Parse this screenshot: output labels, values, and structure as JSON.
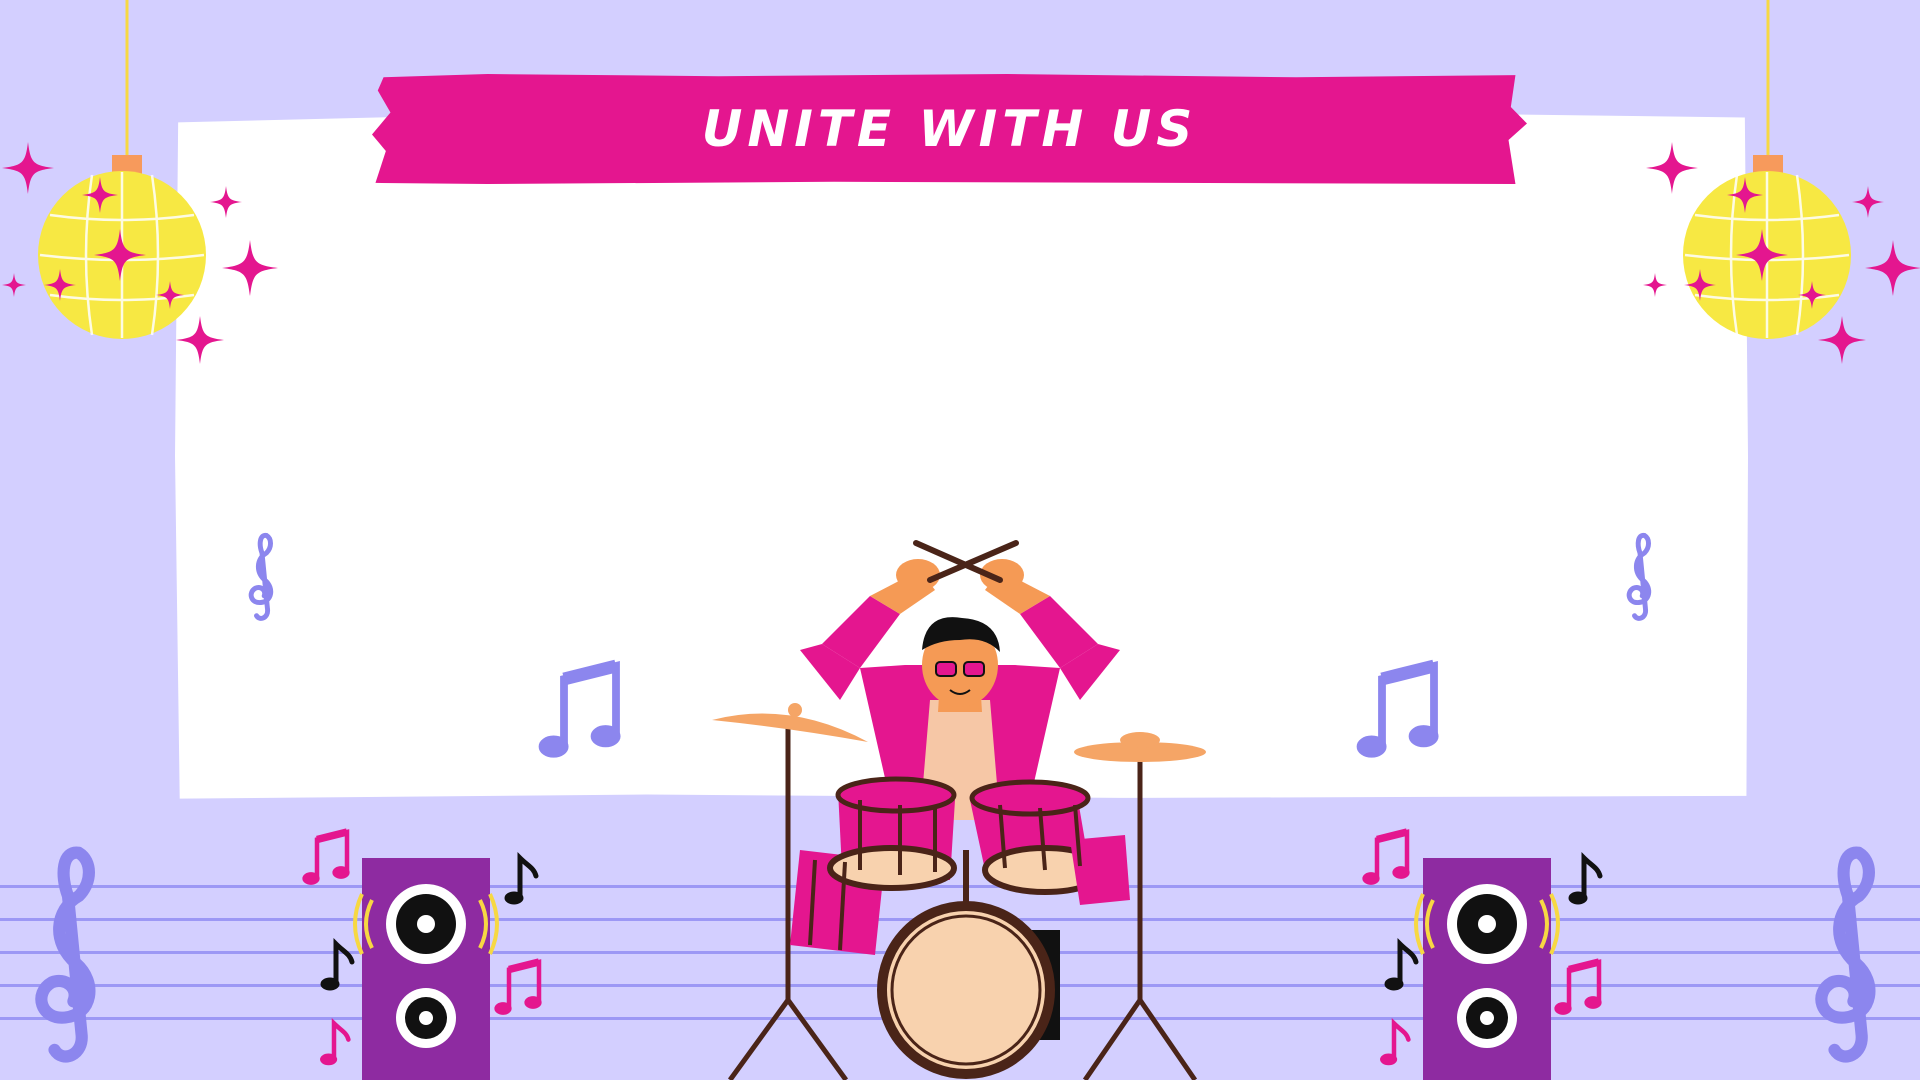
{
  "banner": {
    "title": "UNITE WITH US"
  },
  "colors": {
    "background": "#d3cfff",
    "board": "#ffffff",
    "banner": "#e4168f",
    "accent_pink": "#e4168f",
    "disco_yellow": "#f7e843",
    "speaker_purple": "#8e2ba1",
    "note_lavender": "#8c86ee",
    "skin": "#f59a55"
  },
  "decorations": {
    "icons": [
      "disco-ball-icon",
      "sparkle-icon",
      "treble-clef-icon",
      "music-note-icon",
      "speaker-icon",
      "drum-kit-icon",
      "drummer-icon",
      "cymbal-icon",
      "drumstick-icon"
    ]
  }
}
